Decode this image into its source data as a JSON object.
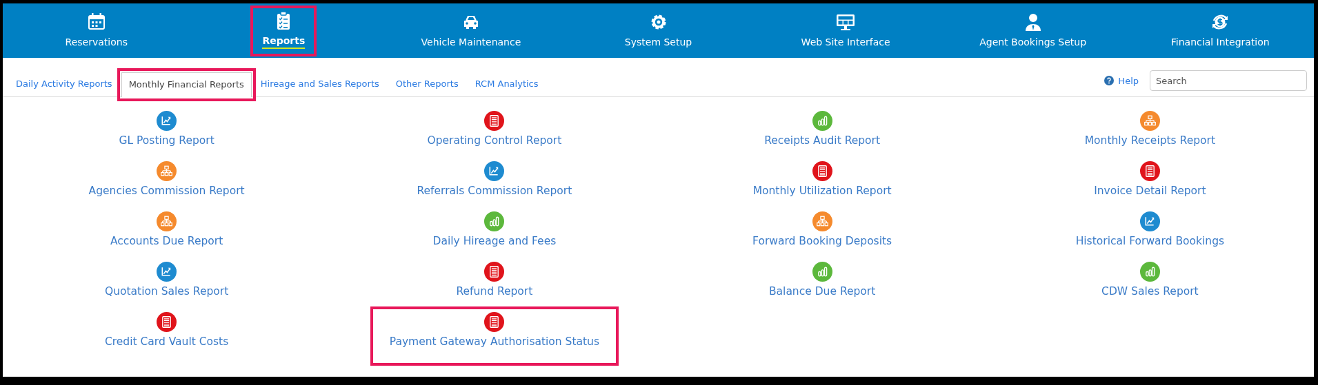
{
  "nav": [
    {
      "label": "Reservations",
      "kind": "calendar",
      "selected": false,
      "highlighted": false
    },
    {
      "label": "Reports",
      "kind": "clipboard",
      "selected": true,
      "highlighted": true
    },
    {
      "label": "Vehicle Maintenance",
      "kind": "car",
      "selected": false,
      "highlighted": false
    },
    {
      "label": "System Setup",
      "kind": "gear",
      "selected": false,
      "highlighted": false
    },
    {
      "label": "Web Site Interface",
      "kind": "monitor",
      "selected": false,
      "highlighted": false
    },
    {
      "label": "Agent Bookings Setup",
      "kind": "person",
      "selected": false,
      "highlighted": false
    },
    {
      "label": "Financial Integration",
      "kind": "dollar",
      "selected": false,
      "highlighted": false
    }
  ],
  "tabs": [
    {
      "label": "Daily Activity Reports",
      "selected": false,
      "highlighted": false
    },
    {
      "label": "Monthly Financial Reports",
      "selected": true,
      "highlighted": true
    },
    {
      "label": "Hireage and Sales Reports",
      "selected": false,
      "highlighted": false
    },
    {
      "label": "Other Reports",
      "selected": false,
      "highlighted": false
    },
    {
      "label": "RCM Analytics",
      "selected": false,
      "highlighted": false
    }
  ],
  "help": {
    "label": "Help"
  },
  "search": {
    "placeholder": "Search"
  },
  "reports": [
    {
      "label": "GL Posting Report",
      "kind": "chart",
      "highlighted": false
    },
    {
      "label": "Operating Control Report",
      "kind": "document",
      "highlighted": false
    },
    {
      "label": "Receipts Audit Report",
      "kind": "bars",
      "highlighted": false
    },
    {
      "label": "Monthly Receipts Report",
      "kind": "hierarchy",
      "highlighted": false
    },
    {
      "label": "Agencies Commission Report",
      "kind": "hierarchy",
      "highlighted": false
    },
    {
      "label": "Referrals Commission Report",
      "kind": "chart",
      "highlighted": false
    },
    {
      "label": "Monthly Utilization Report",
      "kind": "document",
      "highlighted": false
    },
    {
      "label": "Invoice Detail Report",
      "kind": "document",
      "highlighted": false
    },
    {
      "label": "Accounts Due Report",
      "kind": "hierarchy",
      "highlighted": false
    },
    {
      "label": "Daily Hireage and Fees",
      "kind": "bars",
      "highlighted": false
    },
    {
      "label": "Forward Booking Deposits",
      "kind": "hierarchy",
      "highlighted": false
    },
    {
      "label": "Historical Forward Bookings",
      "kind": "chart",
      "highlighted": false
    },
    {
      "label": "Quotation Sales Report",
      "kind": "chart",
      "highlighted": false
    },
    {
      "label": "Refund Report",
      "kind": "document",
      "highlighted": false
    },
    {
      "label": "Balance Due Report",
      "kind": "bars",
      "highlighted": false
    },
    {
      "label": "CDW Sales Report",
      "kind": "bars",
      "highlighted": false
    },
    {
      "label": "Credit Card Vault Costs",
      "kind": "document",
      "highlighted": false
    },
    {
      "label": "Payment Gateway Authorisation Status",
      "kind": "document",
      "highlighted": true
    }
  ]
}
